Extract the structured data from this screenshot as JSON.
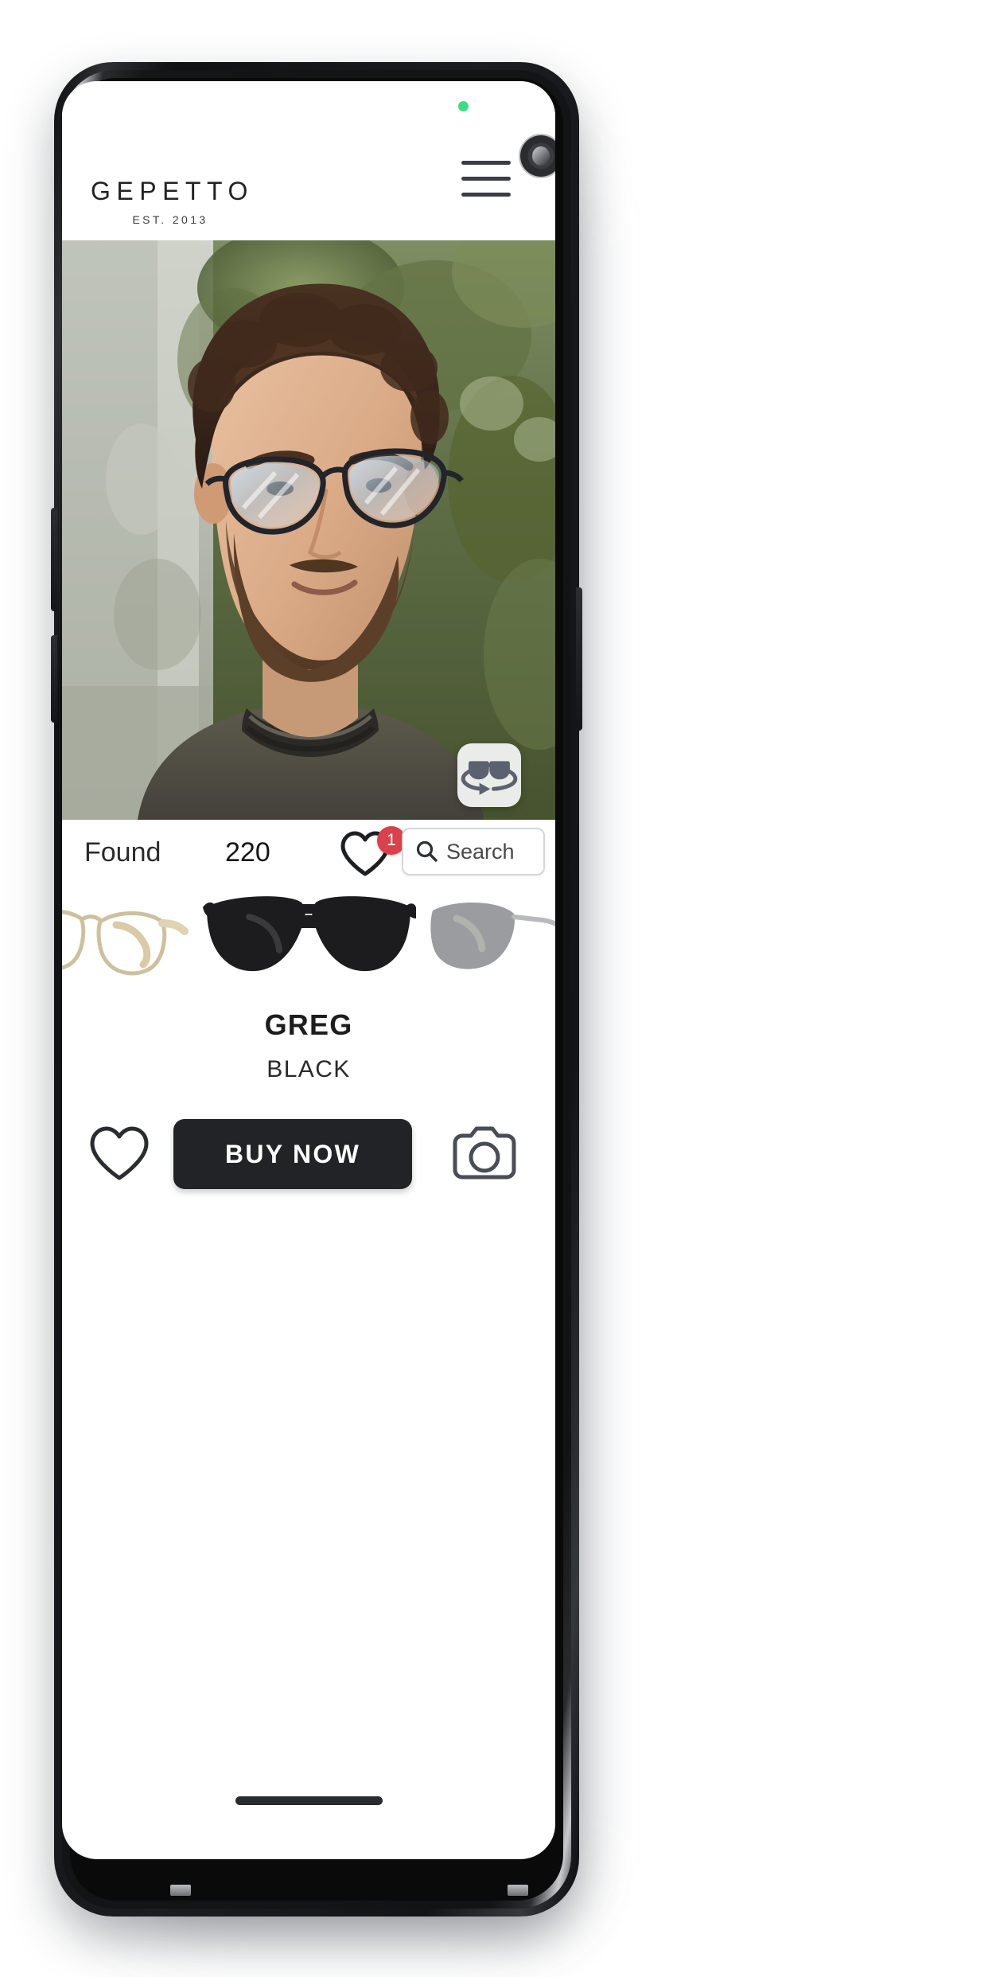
{
  "device": {
    "status_led": "green-indicator-led",
    "front_camera": "punch-hole-camera"
  },
  "header": {
    "brand_name": "GEPETTO",
    "brand_tagline": "EST. 2013",
    "menu_icon": "hamburger-menu-icon"
  },
  "hero": {
    "description": "man-wearing-glasses-photo",
    "ar_button_icon": "rotate-3d-glasses-icon"
  },
  "results": {
    "found_label": "Found",
    "found_count": "220",
    "favorites_icon": "heart-outline-icon",
    "favorites_badge": "1"
  },
  "search": {
    "icon": "magnifier-icon",
    "value": "",
    "placeholder": "Search"
  },
  "carousel": {
    "items": [
      {
        "name": "gold-wire-frame-glasses",
        "position": "previous"
      },
      {
        "name": "black-aviator-glasses",
        "position": "current"
      },
      {
        "name": "rimless-dark-lens-sunglasses",
        "position": "next"
      }
    ]
  },
  "product": {
    "name": "GREG",
    "color": "BLACK"
  },
  "actions": {
    "favorite_icon": "heart-outline-icon",
    "buy_label": "BUY NOW",
    "camera_icon": "camera-outline-icon"
  },
  "colors": {
    "badge_red": "#d9414d",
    "button_dark": "#222326",
    "led_green": "#3ddc84",
    "text_dark": "#1d1d1d"
  }
}
